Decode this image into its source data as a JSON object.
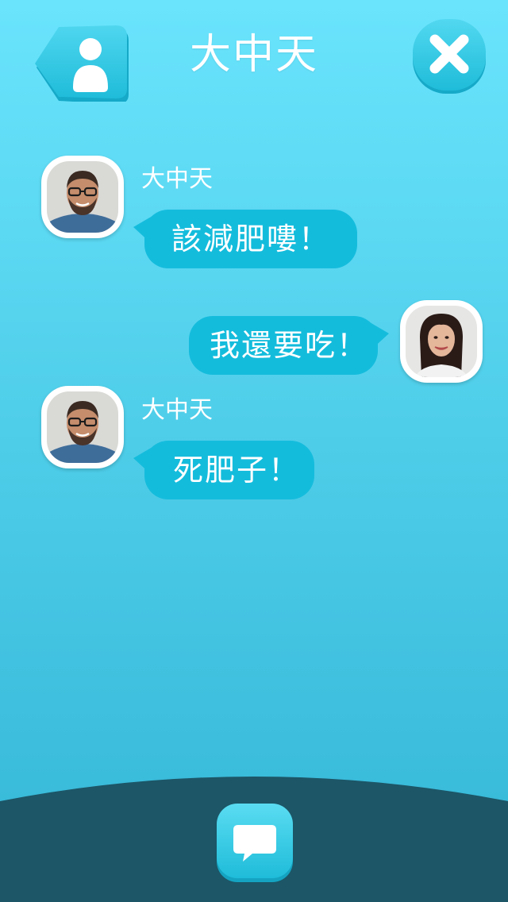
{
  "header": {
    "title": "大中天",
    "back_icon": "user-back-icon",
    "close_icon": "close-icon"
  },
  "messages": [
    {
      "side": "left",
      "sender": "大中天",
      "text": "該減肥嘍！",
      "avatar": "man-avatar"
    },
    {
      "side": "right",
      "sender": "",
      "text": "我還要吃！",
      "avatar": "woman-avatar"
    },
    {
      "side": "left",
      "sender": "大中天",
      "text": "死肥子！",
      "avatar": "man-avatar"
    }
  ],
  "footer": {
    "compose_icon": "chat-bubble-icon"
  },
  "colors": {
    "background_top": "#6ae4fd",
    "background_bottom": "#33b6d6",
    "bubble": "#14bcdc",
    "button": "#2cc8e3",
    "footer": "#1c5667"
  }
}
